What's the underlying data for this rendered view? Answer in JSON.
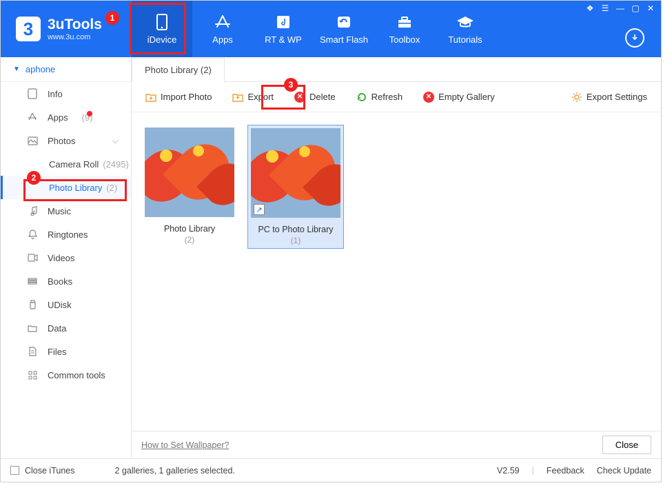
{
  "app": {
    "name": "3uTools",
    "url": "www.3u.com"
  },
  "nav": [
    {
      "label": "iDevice",
      "active": true
    },
    {
      "label": "Apps"
    },
    {
      "label": "RT & WP"
    },
    {
      "label": "Smart Flash"
    },
    {
      "label": "Toolbox"
    },
    {
      "label": "Tutorials"
    }
  ],
  "device_name": "aphone",
  "sidebar": [
    {
      "label": "Info"
    },
    {
      "label": "Apps",
      "count": "(9)",
      "dot": true
    },
    {
      "label": "Photos",
      "expandable": true,
      "children": [
        {
          "label": "Camera Roll",
          "count": "(2495)"
        },
        {
          "label": "Photo Library",
          "count": "(2)",
          "selected": true
        }
      ]
    },
    {
      "label": "Music"
    },
    {
      "label": "Ringtones"
    },
    {
      "label": "Videos"
    },
    {
      "label": "Books"
    },
    {
      "label": "UDisk"
    },
    {
      "label": "Data"
    },
    {
      "label": "Files"
    },
    {
      "label": "Common tools"
    }
  ],
  "tab_label": "Photo Library (2)",
  "toolbar": {
    "import": "Import Photo",
    "export": "Export",
    "delete": "Delete",
    "refresh": "Refresh",
    "empty": "Empty Gallery",
    "settings": "Export Settings"
  },
  "albums": [
    {
      "name": "Photo Library",
      "count": "(2)"
    },
    {
      "name": "PC to Photo Library",
      "count": "(1)",
      "selected": true,
      "shortcut": true
    }
  ],
  "footer": {
    "link": "How to Set Wallpaper?",
    "close": "Close"
  },
  "status": {
    "close_itunes": "Close iTunes",
    "summary": "2 galleries, 1 galleries selected.",
    "version": "V2.59",
    "feedback": "Feedback",
    "check_update": "Check Update"
  },
  "markers": {
    "m1": "1",
    "m2": "2",
    "m3": "3"
  }
}
